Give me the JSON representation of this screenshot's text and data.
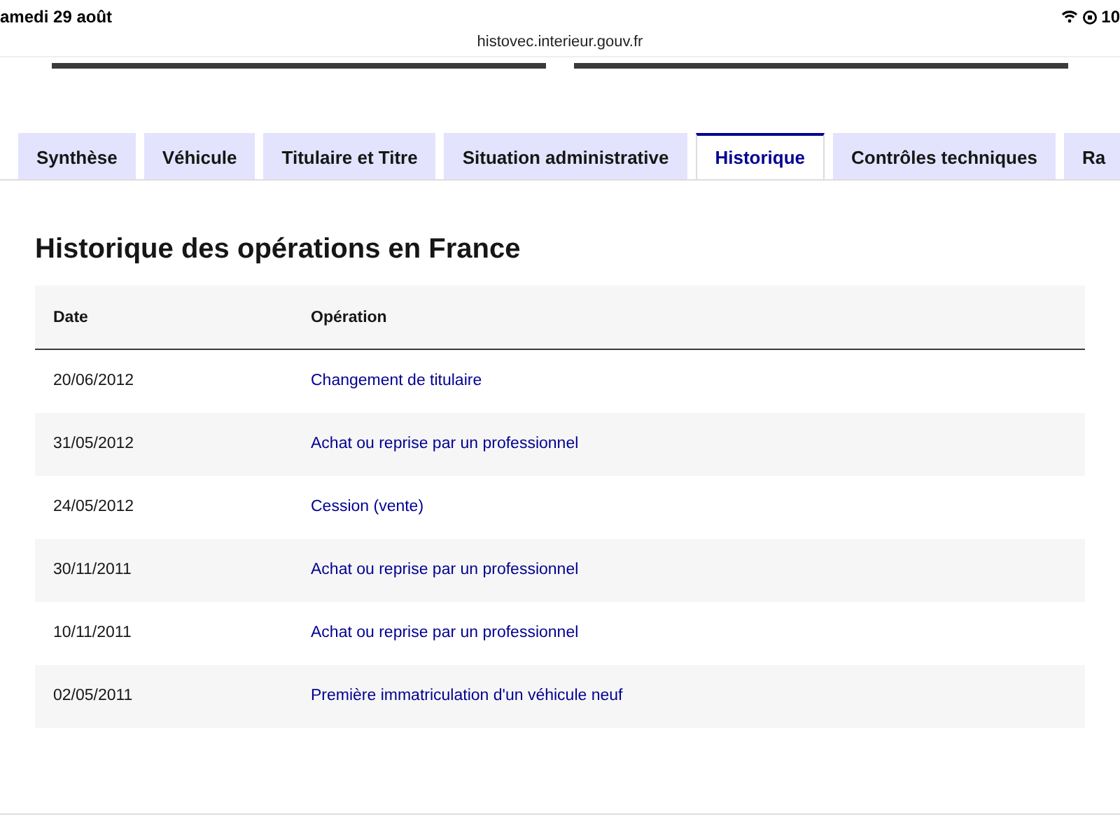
{
  "status_bar": {
    "date": "amedi 29 août",
    "battery": "10"
  },
  "url": "histovec.interieur.gouv.fr",
  "tabs": [
    {
      "label": "Synthèse",
      "selected": false
    },
    {
      "label": "Véhicule",
      "selected": false
    },
    {
      "label": "Titulaire et Titre",
      "selected": false
    },
    {
      "label": "Situation administrative",
      "selected": false
    },
    {
      "label": "Historique",
      "selected": true
    },
    {
      "label": "Contrôles techniques",
      "selected": false
    },
    {
      "label": "Ra",
      "selected": false
    }
  ],
  "section_title": "Historique des opérations en France",
  "table": {
    "columns": [
      "Date",
      "Opération"
    ],
    "rows": [
      [
        "20/06/2012",
        "Changement de titulaire"
      ],
      [
        "31/05/2012",
        "Achat ou reprise par un professionnel"
      ],
      [
        "24/05/2012",
        "Cession (vente)"
      ],
      [
        "30/11/2011",
        "Achat ou reprise par un professionnel"
      ],
      [
        "10/11/2011",
        "Achat ou reprise par un professionnel"
      ],
      [
        "02/05/2011",
        "Première immatriculation d'un véhicule neuf"
      ]
    ]
  }
}
